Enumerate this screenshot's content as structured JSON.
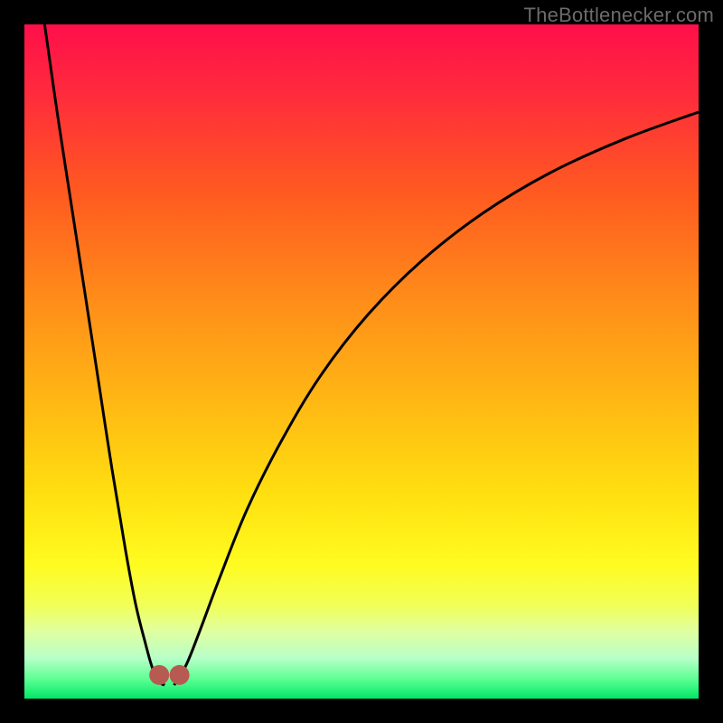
{
  "watermark": "TheBottlenecker.com",
  "gradient_stops": [
    {
      "offset": 0.0,
      "color": "#ff0f4a"
    },
    {
      "offset": 0.1,
      "color": "#ff2a3d"
    },
    {
      "offset": 0.25,
      "color": "#ff5a20"
    },
    {
      "offset": 0.4,
      "color": "#ff8a1a"
    },
    {
      "offset": 0.55,
      "color": "#ffb514"
    },
    {
      "offset": 0.7,
      "color": "#ffe010"
    },
    {
      "offset": 0.8,
      "color": "#fffb20"
    },
    {
      "offset": 0.86,
      "color": "#f2ff55"
    },
    {
      "offset": 0.9,
      "color": "#e0ffa0"
    },
    {
      "offset": 0.94,
      "color": "#b8ffc8"
    },
    {
      "offset": 0.97,
      "color": "#60ff95"
    },
    {
      "offset": 1.0,
      "color": "#00e867"
    }
  ],
  "marker": {
    "color": "#b75a52",
    "radius": 11
  },
  "curve_style": {
    "stroke": "#000000",
    "width": 3
  },
  "chart_data": {
    "type": "line",
    "title": "",
    "xlabel": "",
    "ylabel": "",
    "xlim": [
      0,
      100
    ],
    "ylim": [
      0,
      100
    ],
    "grid": false,
    "series": [
      {
        "name": "left-branch",
        "x": [
          3,
          5,
          7,
          9,
          11,
          13,
          15,
          16.5,
          18,
          19,
          20,
          20.8
        ],
        "y": [
          100,
          86,
          73,
          60,
          47,
          34,
          22,
          14,
          8,
          4.5,
          2.5,
          2
        ]
      },
      {
        "name": "right-branch",
        "x": [
          22.2,
          24,
          26,
          29,
          33,
          38,
          44,
          51,
          59,
          68,
          78,
          89,
          100
        ],
        "y": [
          2,
          5,
          10,
          18,
          28,
          38,
          48,
          57,
          65,
          72,
          78,
          83,
          87
        ]
      }
    ],
    "markers": [
      {
        "name": "valley-left",
        "x": 20.0,
        "y": 3.5
      },
      {
        "name": "valley-right",
        "x": 23.0,
        "y": 3.5
      }
    ],
    "minimum_x": 21.5
  }
}
